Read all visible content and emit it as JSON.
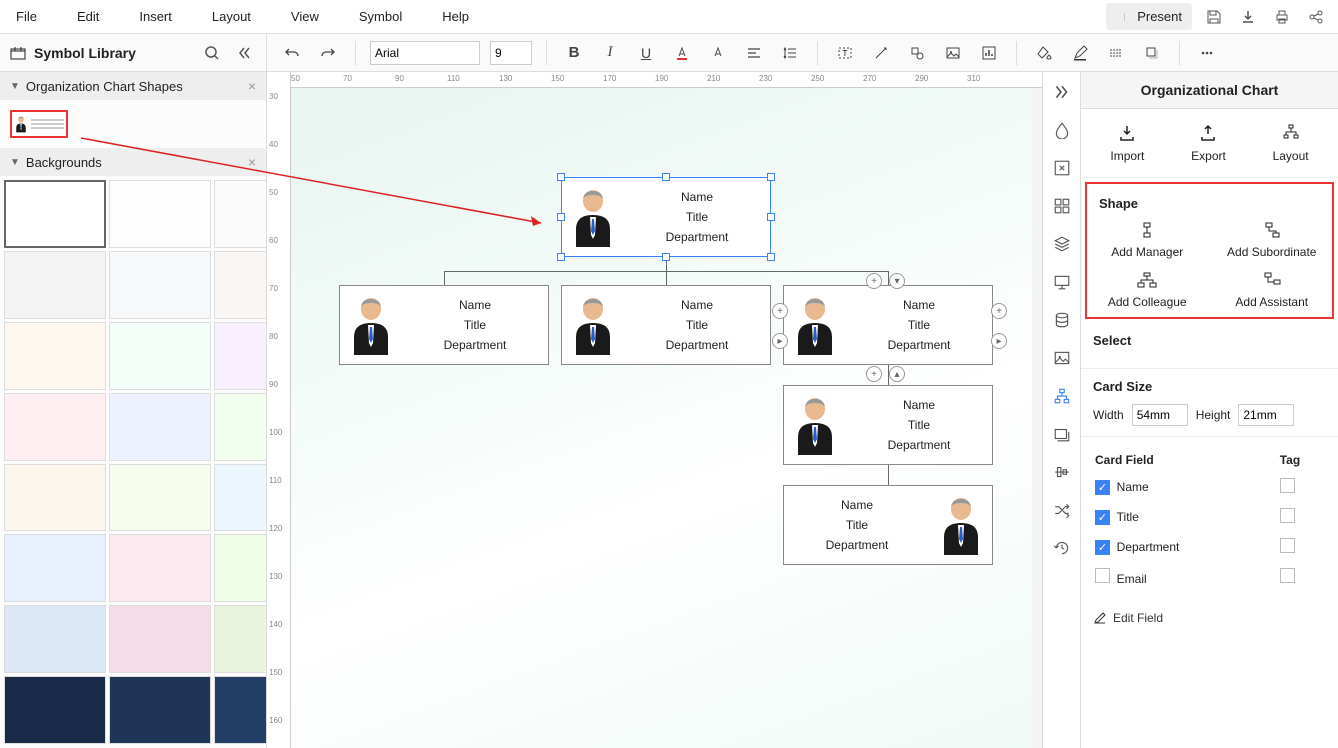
{
  "menu": [
    "File",
    "Edit",
    "Insert",
    "Layout",
    "View",
    "Symbol",
    "Help"
  ],
  "present_label": "Present",
  "symbol_library_label": "Symbol Library",
  "panels": {
    "org_shapes": "Organization Chart Shapes",
    "backgrounds": "Backgrounds"
  },
  "toolbar": {
    "font": "Arial",
    "size": "9"
  },
  "ruler_h": [
    "50",
    "70",
    "90",
    "110",
    "130",
    "150",
    "170",
    "190",
    "210",
    "230",
    "250",
    "270",
    "290",
    "310"
  ],
  "ruler_v": [
    "30",
    "40",
    "50",
    "60",
    "70",
    "80",
    "90",
    "100",
    "110",
    "120",
    "130",
    "140",
    "150",
    "160"
  ],
  "node_fields": {
    "name": "Name",
    "title": "Title",
    "dept": "Department"
  },
  "rpanel": {
    "title": "Organizational Chart",
    "import": "Import",
    "export": "Export",
    "layout": "Layout",
    "shape_label": "Shape",
    "add_manager": "Add Manager",
    "add_subordinate": "Add Subordinate",
    "add_colleague": "Add Colleague",
    "add_assistant": "Add Assistant",
    "select_label": "Select",
    "card_size_label": "Card Size",
    "width_label": "Width",
    "width_val": "54mm",
    "height_label": "Height",
    "height_val": "21mm",
    "card_field_label": "Card Field",
    "tag_label": "Tag",
    "fields": [
      {
        "label": "Name",
        "on": true,
        "tag": false
      },
      {
        "label": "Title",
        "on": true,
        "tag": false
      },
      {
        "label": "Department",
        "on": true,
        "tag": false
      },
      {
        "label": "Email",
        "on": false,
        "tag": false
      }
    ],
    "edit_field": "Edit Field"
  },
  "bg_colors": [
    "#ffffff",
    "#fdfdfd",
    "#fbfbfb",
    "#fafafa",
    "#f9f9f9",
    "#f4f4f4",
    "#f6f8fa",
    "#f9f6f4",
    "#f4f9f6",
    "#f6f4f9",
    "#fff8f0",
    "#f0fff8",
    "#f8f0ff",
    "#f0f8ff",
    "#fff0f8",
    "#ffeef2",
    "#eef2ff",
    "#f2ffee",
    "#fff2ee",
    "#eefff2",
    "#fdf6ec",
    "#f6fdec",
    "#ecf6fd",
    "#fdecf6",
    "#ecfdf6",
    "#e8f0fe",
    "#fee8f0",
    "#f0fee8",
    "#e8fef0",
    "#fef0e8",
    "#dce8f5",
    "#f5dce8",
    "#e8f5dc",
    "#dcf5e8",
    "#f5e8dc",
    "#1a2b4a",
    "#1f3558",
    "#223d66",
    "#1b2e50",
    "#24406c"
  ]
}
